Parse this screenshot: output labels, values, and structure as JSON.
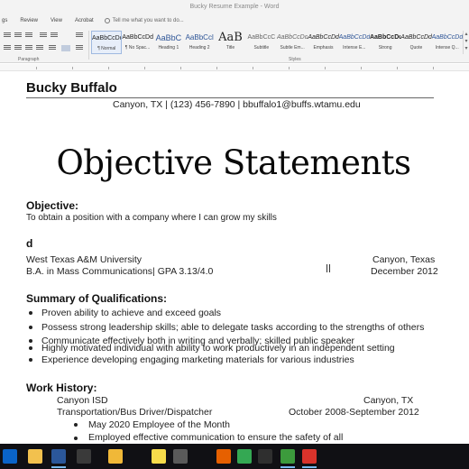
{
  "titlebar": {
    "text": "Bucky Resume Example - Word"
  },
  "menu": {
    "items": [
      "gs",
      "Review",
      "View",
      "Acrobat"
    ],
    "tell_me": "Tell me what you want to do..."
  },
  "ribbon": {
    "paragraph_label": "Paragraph",
    "styles_label": "Styles",
    "styles": [
      {
        "preview": "AaBbCcDd",
        "name": "¶ Normal",
        "selected": true
      },
      {
        "preview": "AaBbCcDd",
        "name": "¶ No Spac..."
      },
      {
        "preview": "AaBbC",
        "name": "Heading 1"
      },
      {
        "preview": "AaBbCcl",
        "name": "Heading 2"
      },
      {
        "preview": "AaB",
        "name": "Title"
      },
      {
        "preview": "AaBbCcC",
        "name": "Subtitle"
      },
      {
        "preview": "AaBbCcDd",
        "name": "Subtle Em..."
      },
      {
        "preview": "AaBbCcDd",
        "name": "Emphasis"
      },
      {
        "preview": "AaBbCcDd",
        "name": "Intense E..."
      },
      {
        "preview": "AaBbCcDd",
        "name": "Strong"
      },
      {
        "preview": "AaBbCcDd",
        "name": "Quote"
      },
      {
        "preview": "AaBbCcDd",
        "name": "Intense Q..."
      }
    ]
  },
  "resume": {
    "name": "Bucky Buffalo",
    "contact": "Canyon, TX | (123) 456-7890 | bbuffalo1@buffs.wtamu.edu",
    "objective_heading": "Objective:",
    "objective_text": "To obtain a position with a company where I can grow my skills",
    "education_fragment": "d",
    "university": "West Texas A&M University",
    "university_location": "Canyon, Texas",
    "degree": "B.A. in Mass Communications| GPA 3.13/4.0",
    "grad_date": "December 2012",
    "qualifications_heading": "Summary of Qualifications:",
    "qualifications": [
      "Proven ability to achieve and exceed goals",
      "Possess strong leadership skills; able to delegate tasks according to the strengths of others",
      "Communicate effectively both in writing and verbally; skilled public speaker",
      "Highly motivated individual with ability to work productively in an independent setting",
      "Experience developing engaging marketing materials for various industries"
    ],
    "work_heading": "Work History:",
    "employer": "Canyon ISD",
    "employer_location": "Canyon, TX",
    "job_title": "Transportation/Bus Driver/Dispatcher",
    "job_dates": "October 2008-September 2012",
    "job_bullets": [
      "May 2020 Employee of the Month",
      "Employed effective communication to ensure the safety of all"
    ]
  },
  "overlay_title": "Objective Statements",
  "taskbar": {
    "icons": [
      {
        "name": "outlook-icon",
        "color": "#0a64c8"
      },
      {
        "name": "file-explorer-icon",
        "color": "#f2c14e"
      },
      {
        "name": "word-icon",
        "color": "#2b579a"
      },
      {
        "name": "task-view-icon",
        "color": "#3a3a3a"
      },
      {
        "name": "file-explorer-2-icon",
        "color": "#f0b838"
      },
      {
        "name": "sticky-notes-icon",
        "color": "#f7dc4b"
      },
      {
        "name": "calculator-icon",
        "color": "#5a5a5a"
      },
      {
        "name": "firefox-icon",
        "color": "#e66000"
      },
      {
        "name": "chrome-icon",
        "color": "#34a853"
      },
      {
        "name": "settings-icon",
        "color": "#2f2f2f"
      },
      {
        "name": "camtasia-icon",
        "color": "#3c9b3c"
      },
      {
        "name": "recorder-icon",
        "color": "#d9332b"
      }
    ]
  }
}
